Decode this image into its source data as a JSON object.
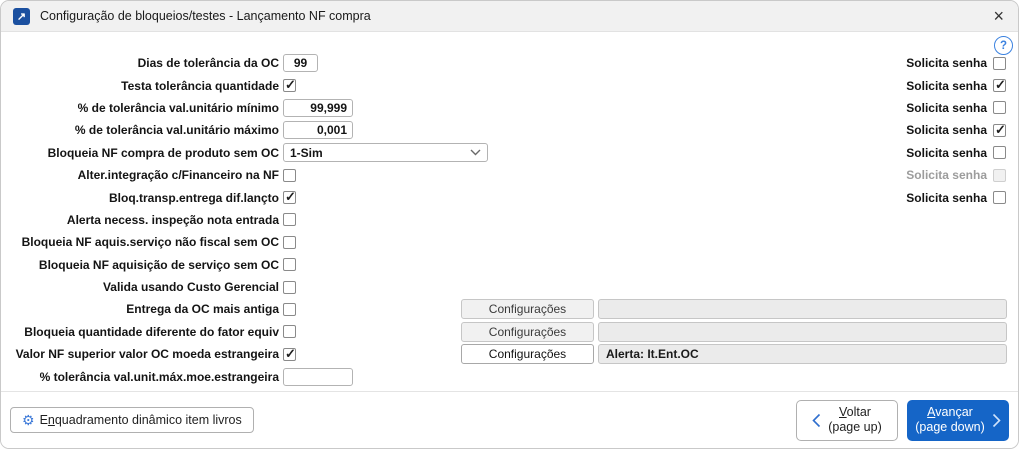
{
  "window": {
    "title": "Configuração de bloqueios/testes - Lançamento NF compra",
    "icons": {
      "app": "↗",
      "close": "×",
      "help": "?",
      "gear": "⚙"
    }
  },
  "form": {
    "solicita_label": "Solicita senha",
    "config_button_label": "Configurações",
    "rows": [
      {
        "label": "Dias de tolerância da OC",
        "control": {
          "type": "input",
          "value": "99"
        },
        "solicita": {
          "checked": false
        }
      },
      {
        "label": "Testa tolerância quantidade",
        "control": {
          "type": "checkbox",
          "checked": true
        },
        "solicita": {
          "checked": true
        }
      },
      {
        "label": "% de tolerância val.unitário mínimo",
        "control": {
          "type": "input",
          "value": "99,999"
        },
        "solicita": {
          "checked": false
        }
      },
      {
        "label": "% de tolerância val.unitário máximo",
        "control": {
          "type": "input",
          "value": "0,001"
        },
        "solicita": {
          "checked": true
        }
      },
      {
        "label": "Bloqueia NF compra de produto sem OC",
        "control": {
          "type": "select",
          "value": "1-Sim"
        },
        "solicita": {
          "checked": false
        }
      },
      {
        "label": "Alter.integração c/Financeiro na NF",
        "control": {
          "type": "checkbox",
          "checked": false
        },
        "solicita": {
          "checked": false,
          "disabled": true
        }
      },
      {
        "label": "Bloq.transp.entrega dif.lançto",
        "control": {
          "type": "checkbox",
          "checked": true
        },
        "solicita": {
          "checked": false
        }
      },
      {
        "label": "Alerta necess. inspeção nota entrada",
        "control": {
          "type": "checkbox",
          "checked": false
        }
      },
      {
        "label": "Bloqueia NF aquis.serviço não fiscal sem OC",
        "control": {
          "type": "checkbox",
          "checked": false
        }
      },
      {
        "label": "Bloqueia NF aquisição de serviço sem OC",
        "control": {
          "type": "checkbox",
          "checked": false
        }
      },
      {
        "label": "Valida usando Custo Gerencial",
        "control": {
          "type": "checkbox",
          "checked": false
        }
      },
      {
        "label": "Entrega da OC mais antiga",
        "control": {
          "type": "checkbox",
          "checked": false
        },
        "config": {
          "enabled": false,
          "field_text": ""
        }
      },
      {
        "label": "Bloqueia quantidade diferente do fator equiv",
        "control": {
          "type": "checkbox",
          "checked": false
        },
        "config": {
          "enabled": false,
          "field_text": ""
        }
      },
      {
        "label": "Valor NF superior valor OC moeda estrangeira",
        "control": {
          "type": "checkbox",
          "checked": true
        },
        "config": {
          "enabled": true,
          "field_text": "Alerta: It.Ent.OC"
        }
      },
      {
        "label": "% tolerância val.unit.máx.moe.estrangeira",
        "control": {
          "type": "input",
          "value": ""
        }
      }
    ]
  },
  "footer": {
    "enquadramento": {
      "pre": "E",
      "key": "n",
      "post": "quadramento dinâmico item livros"
    },
    "voltar": {
      "pre": "",
      "key": "V",
      "post": "oltar",
      "line2": "(page up)"
    },
    "avancar": {
      "pre": "",
      "key": "A",
      "post": "vançar",
      "line2": "(page down)"
    }
  },
  "colors": {
    "accent_blue": "#1565c7",
    "app_icon_blue": "#1b50a0",
    "help_blue": "#3b82e0"
  }
}
